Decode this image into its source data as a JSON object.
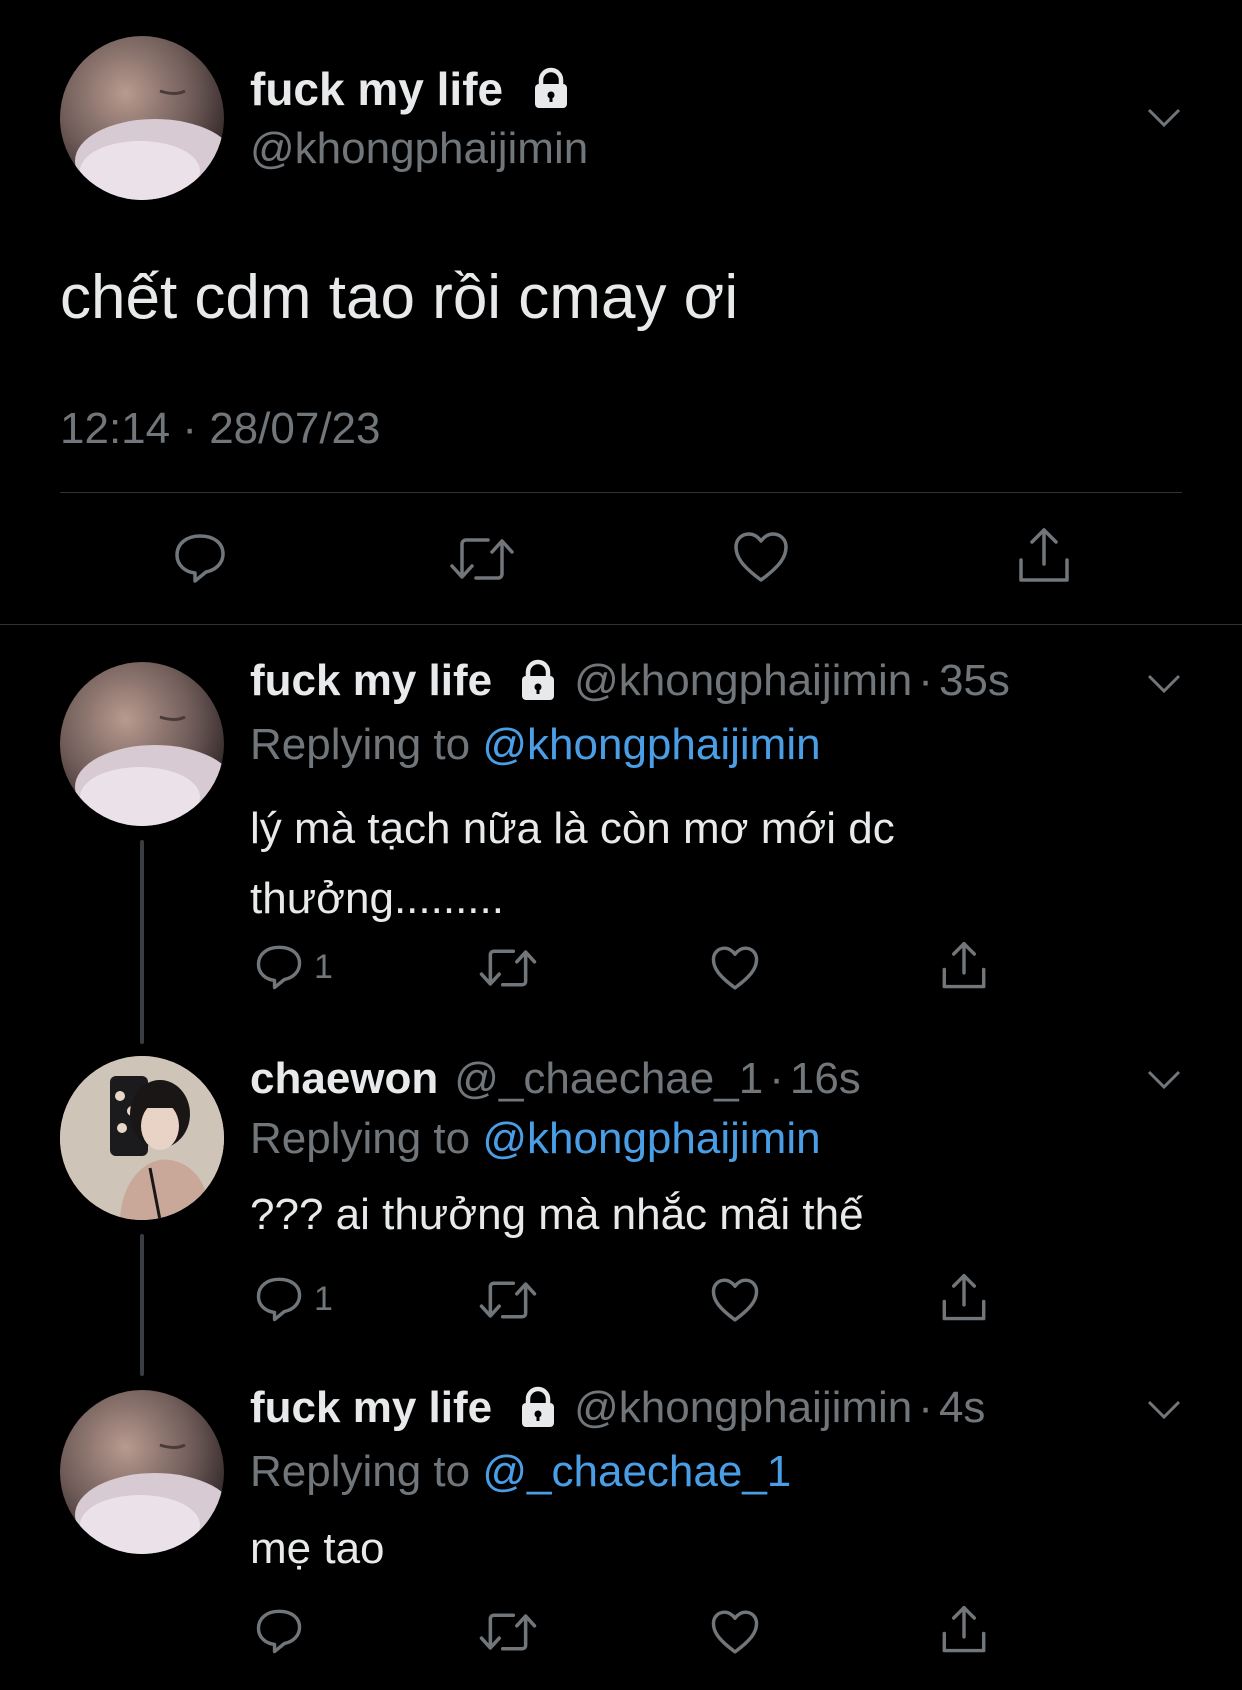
{
  "main_tweet": {
    "display_name": "fuck my life",
    "handle": "@khongphaijimin",
    "text": "chết cdm tao rồi cmay ơi",
    "timestamp": "12:14 · 28/07/23"
  },
  "replies": [
    {
      "display_name": "fuck my life",
      "handle": "@khongphaijimin",
      "sep": "·",
      "time": "35s",
      "replying_prefix": "Replying to",
      "replying_to": "@khongphaijimin",
      "text_line1": "lý mà tạch nữa là còn mơ mới dc",
      "text_line2": "thưởng.........",
      "reply_count": "1"
    },
    {
      "display_name": "chaewon",
      "handle": "@_chaechae_1",
      "sep": "·",
      "time": "16s",
      "replying_prefix": "Replying to",
      "replying_to": "@khongphaijimin",
      "text_line1": "??? ai thưởng mà nhắc mãi thế",
      "reply_count": "1"
    },
    {
      "display_name": "fuck my life",
      "handle": "@khongphaijimin",
      "sep": "·",
      "time": "4s",
      "replying_prefix": "Replying to",
      "replying_to": "@_chaechae_1",
      "text_line1": "mẹ tao",
      "reply_count": ""
    }
  ],
  "colors": {
    "background": "#000000",
    "text": "#e7e9ea",
    "muted": "#71767b",
    "link": "#4a9ee6",
    "divider": "#2f3336"
  },
  "icons": [
    "lock-icon",
    "chevron-down-icon",
    "reply-icon",
    "retweet-icon",
    "like-icon",
    "share-icon"
  ]
}
